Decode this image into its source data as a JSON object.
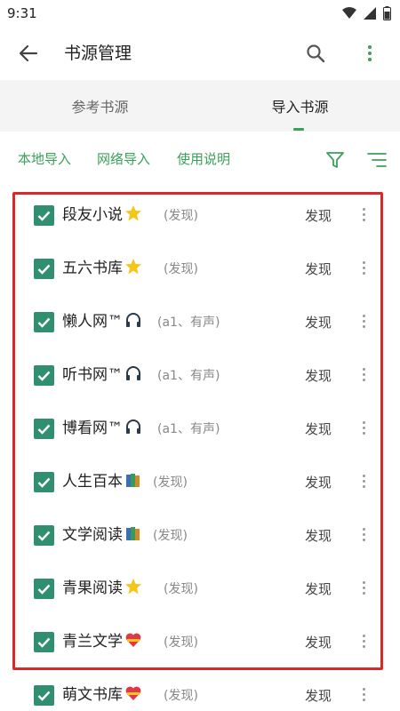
{
  "status_bar": {
    "time": "9:31"
  },
  "app_bar": {
    "title": "书源管理",
    "back_icon": "arrow-left-icon",
    "search_icon": "search-icon",
    "more_icon": "more-vert-icon"
  },
  "tabs": [
    {
      "label": "参考书源",
      "active": false
    },
    {
      "label": "导入书源",
      "active": true
    }
  ],
  "actions": {
    "local_import": "本地导入",
    "network_import": "网络导入",
    "usage_guide": "使用说明",
    "filter_icon": "filter-icon",
    "sort_icon": "sort-icon"
  },
  "colors": {
    "accent": "#3aa05a",
    "checkbox": "#2f8f6f",
    "highlight_border": "#d62a2a"
  },
  "sources": [
    {
      "name": "段友小说",
      "badge": "star",
      "tag": "(发现)",
      "action": "发现",
      "checked": true
    },
    {
      "name": "五六书库",
      "badge": "star",
      "tag": "(发现)",
      "action": "发现",
      "checked": true
    },
    {
      "name": "懒人网™",
      "badge": "headphones",
      "tag": "(a1、有声)",
      "action": "发现",
      "checked": true
    },
    {
      "name": "听书网™",
      "badge": "headphones",
      "tag": "(a1、有声)",
      "action": "发现",
      "checked": true
    },
    {
      "name": "博看网™",
      "badge": "headphones",
      "tag": "(a1、有声)",
      "action": "发现",
      "checked": true
    },
    {
      "name": "人生百本",
      "badge": "books",
      "tag": "(发现)",
      "action": "发现",
      "checked": true
    },
    {
      "name": "文学阅读",
      "badge": "books",
      "tag": "(发现)",
      "action": "发现",
      "checked": true
    },
    {
      "name": "青果阅读",
      "badge": "star",
      "tag": "(发现)",
      "action": "发现",
      "checked": true
    },
    {
      "name": "青兰文学",
      "badge": "heart",
      "tag": "(发现)",
      "action": "发现",
      "checked": true
    },
    {
      "name": "萌文书库",
      "badge": "heart",
      "tag": "(发现)",
      "action": "发现",
      "checked": true
    }
  ]
}
